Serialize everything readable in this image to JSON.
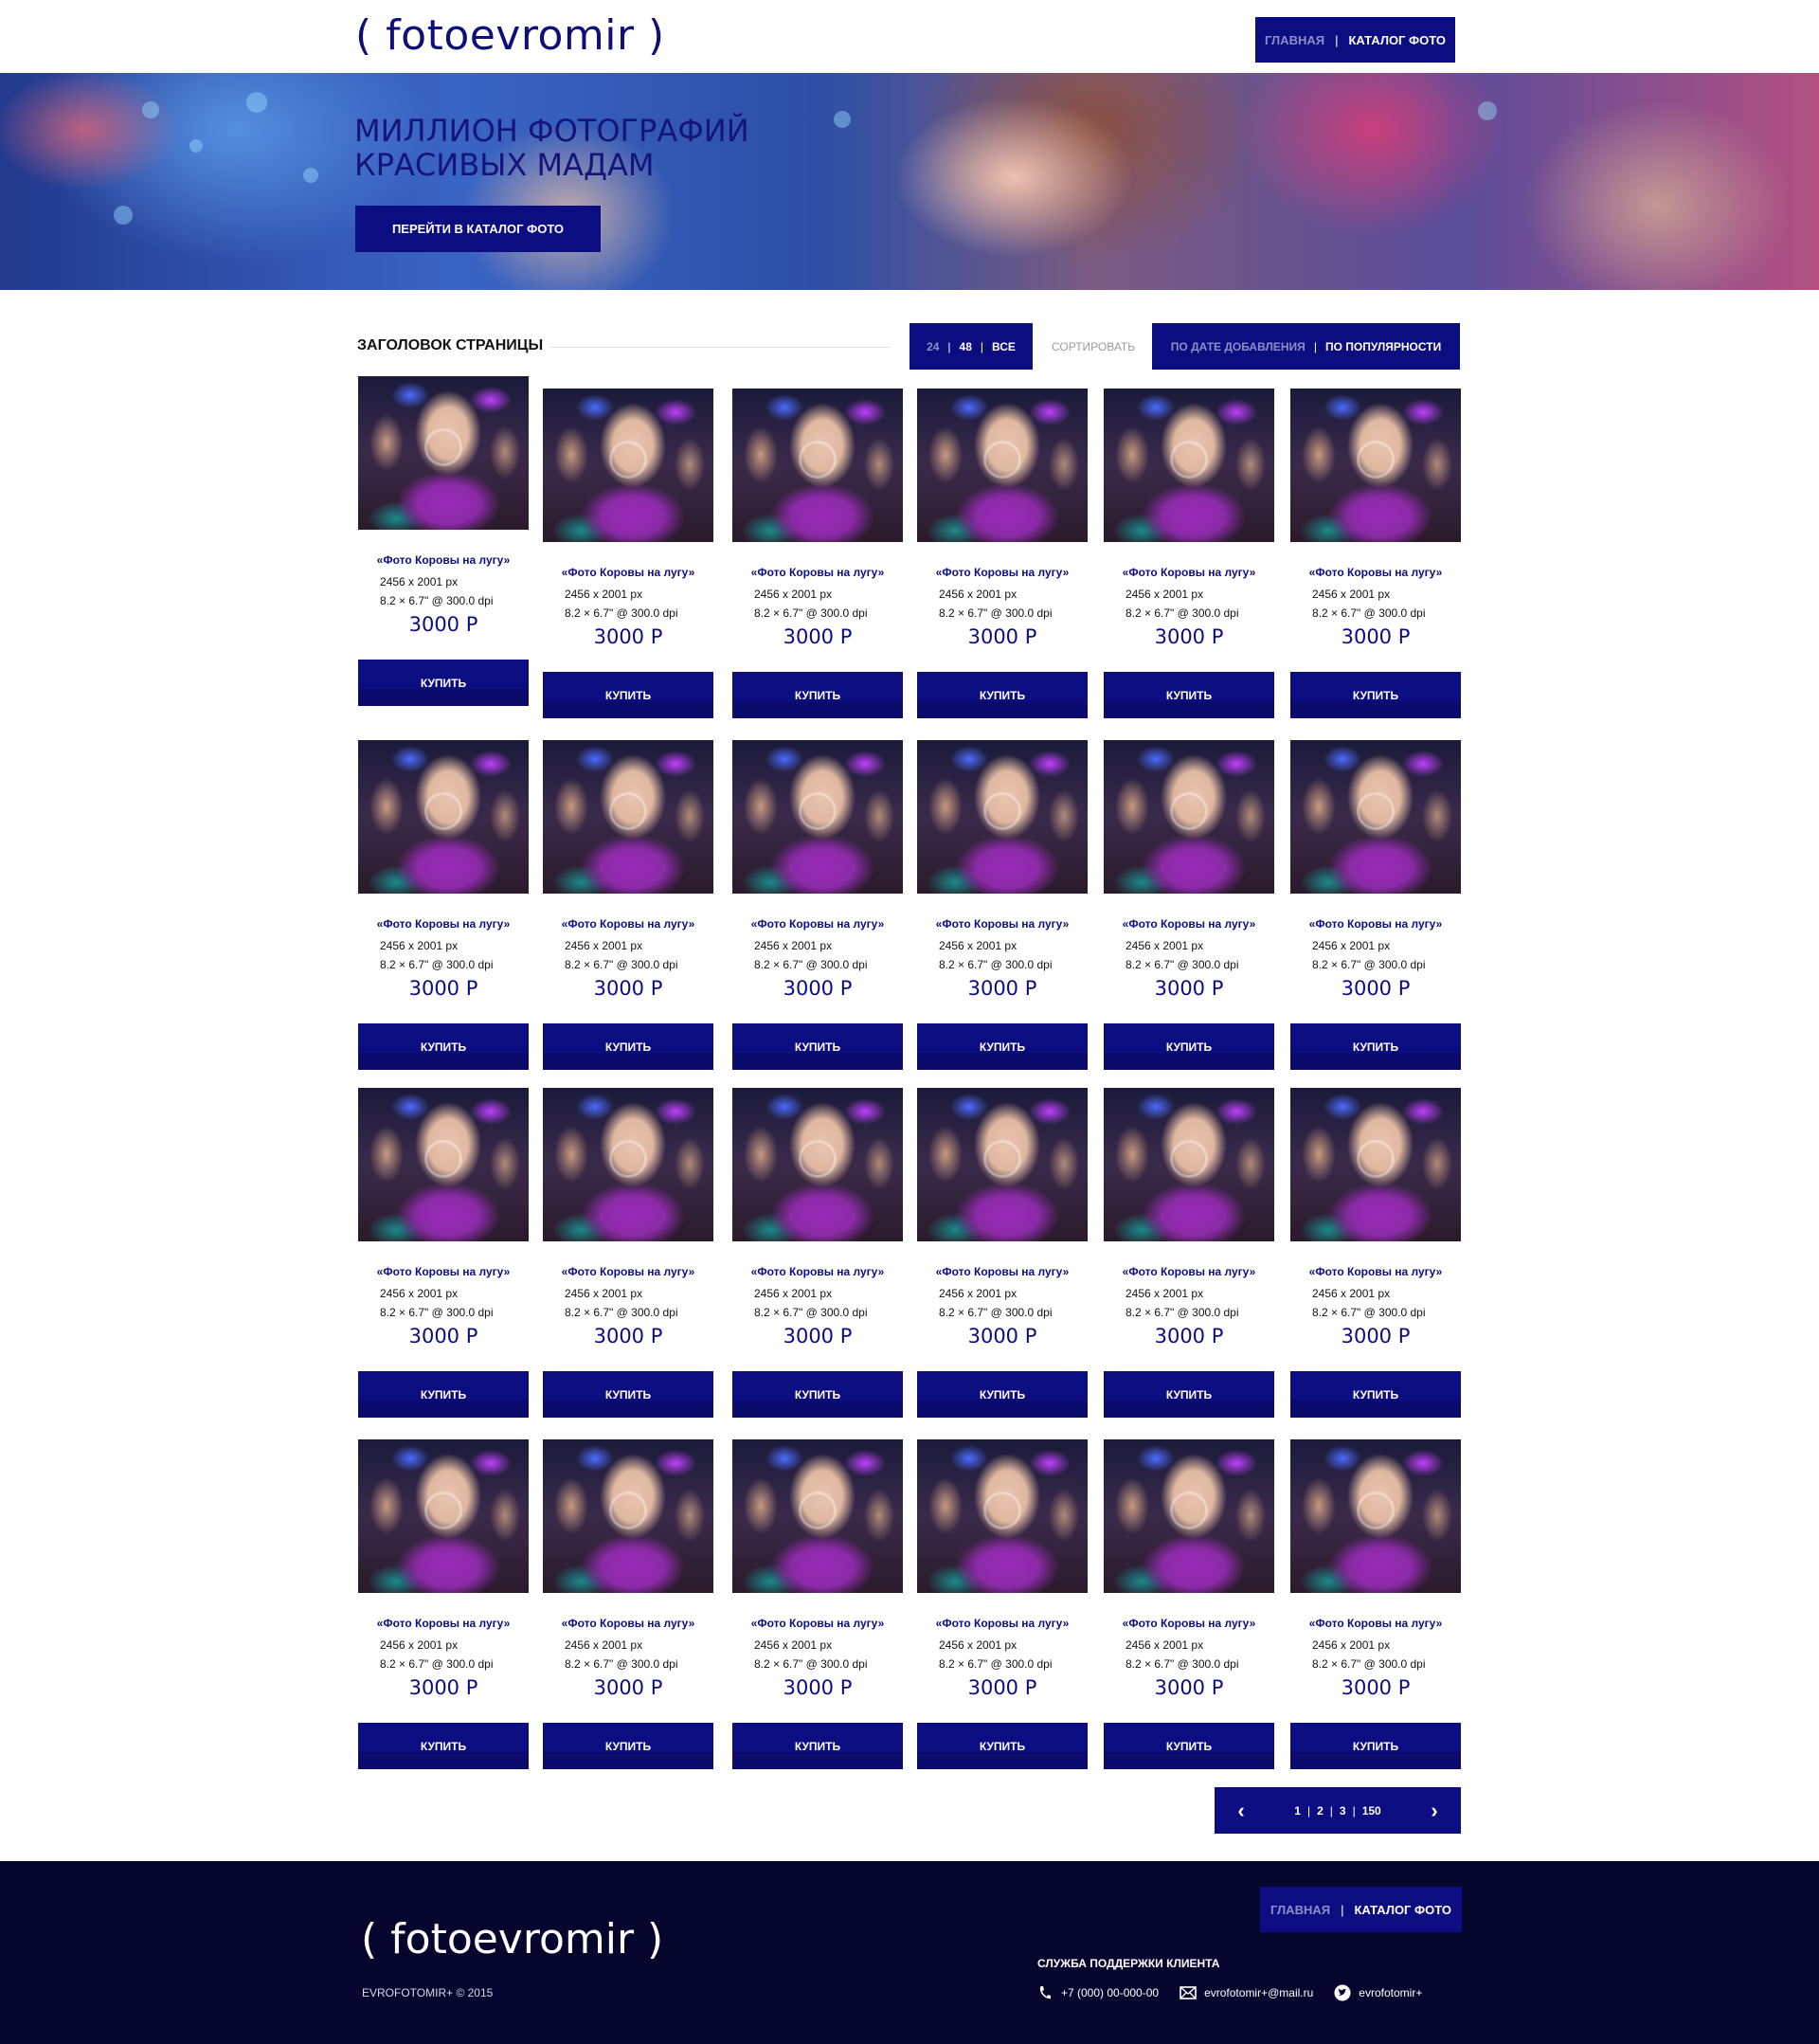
{
  "header": {
    "logo": "( fotoevromir )",
    "nav": {
      "home": "ГЛАВНАЯ",
      "catalog": "КАТАЛОГ ФОТО"
    }
  },
  "hero": {
    "title_line1": "МИЛЛИОН ФОТОГРАФИЙ",
    "title_line2": "КРАСИВЫХ МАДАМ",
    "button": "ПЕРЕЙТИ В КАТАЛОГ ФОТО"
  },
  "toolbar": {
    "page_title": "ЗАГОЛОВОК СТРАНИЦЫ",
    "per_page": [
      "24",
      "48",
      "ВСЕ"
    ],
    "sort_label": "СОРТИРОВАТЬ",
    "sort_options": [
      "ПО ДАТЕ ДОБАВЛЕНИЯ",
      "ПО ПОПУЛЯРНОСТИ"
    ]
  },
  "product": {
    "title": "«Фото Коровы на лугу»",
    "size": "2456 x 2001 px",
    "print": "8.2 × 6.7\" @ 300.0 dpi",
    "price": "3000 Р",
    "buy": "КУПИТЬ"
  },
  "pagination": {
    "pages": [
      "1",
      "2",
      "3",
      "150"
    ]
  },
  "footer": {
    "logo": "( fotoevromir )",
    "copyright": "EVROFOTOMIR+ © 2015",
    "nav": {
      "home": "ГЛАВНАЯ",
      "catalog": "КАТАЛОГ ФОТО"
    },
    "support_title": "СЛУЖБА ПОДДЕРЖКИ КЛИЕНТА",
    "phone": "+7 (000) 00-000-00",
    "email": "evrofotomir+@mail.ru",
    "twitter": "evrofotomir+"
  },
  "colors": {
    "brand": "#0d0d82",
    "footer_bg": "#05052e",
    "inactive_nav": "#8c8ec8"
  }
}
